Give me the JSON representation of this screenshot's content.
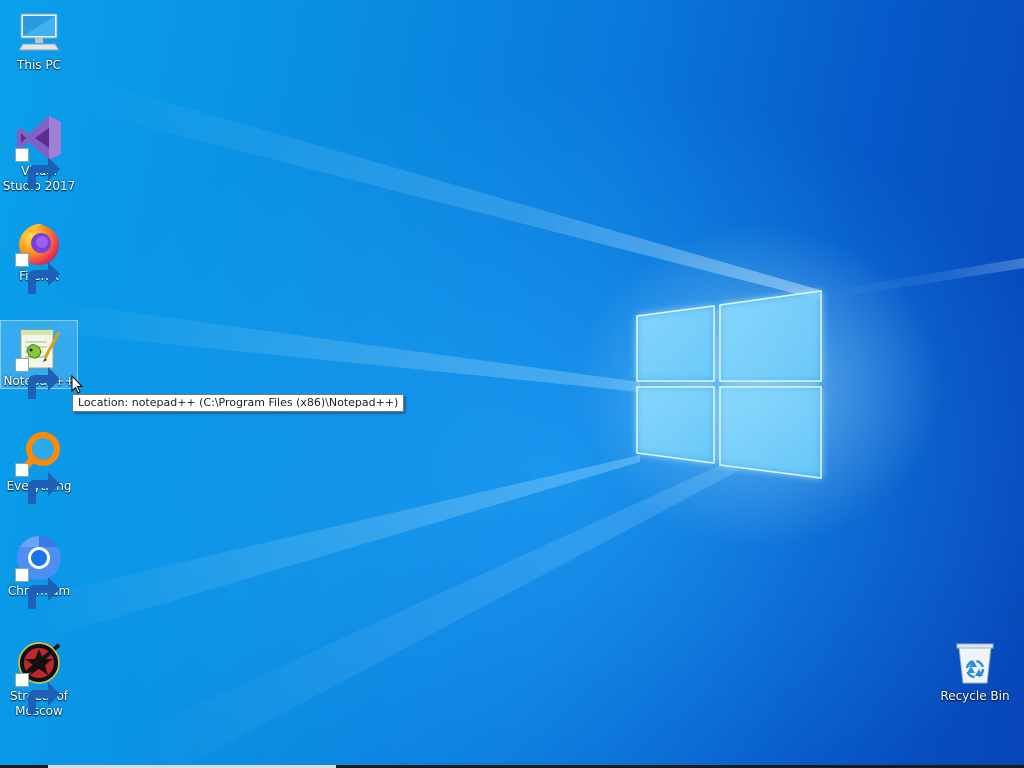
{
  "desktop": {
    "icons": [
      {
        "label": "This PC",
        "icon": "computer-icon",
        "shortcut": false
      },
      {
        "label": "Visual Studio 2017",
        "icon": "visual-studio-icon",
        "shortcut": true
      },
      {
        "label": "Firefox",
        "icon": "firefox-icon",
        "shortcut": true
      },
      {
        "label": "Notepad++",
        "icon": "notepad-plus-plus-icon",
        "shortcut": true,
        "selected": true
      },
      {
        "label": "Everything",
        "icon": "everything-search-icon",
        "shortcut": true
      },
      {
        "label": "Chromium",
        "icon": "chromium-icon",
        "shortcut": true
      },
      {
        "label": "Streets of Moscow",
        "icon": "streets-of-moscow-icon",
        "shortcut": true
      },
      {
        "label": "Recycle Bin",
        "icon": "recycle-bin-icon",
        "shortcut": false
      }
    ],
    "tooltip": "Location: notepad++ (C:\\Program Files (x86)\\Notepad++)"
  },
  "colors": {
    "wallpaper_light": "#0aa0ec",
    "wallpaper_dark": "#0746b8",
    "logo_glow": "#aeeaff"
  }
}
